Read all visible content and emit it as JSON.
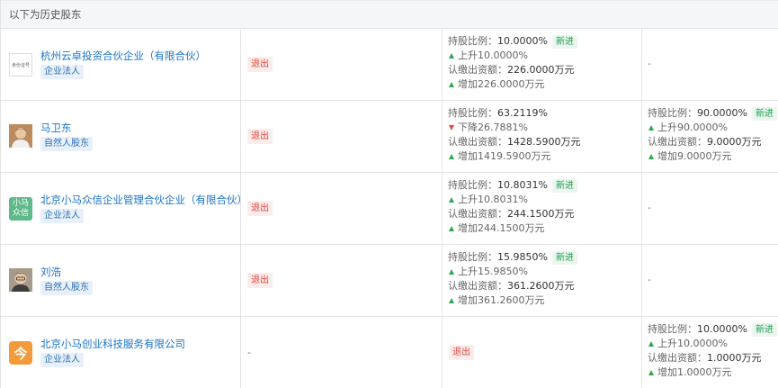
{
  "header": {
    "title": "以下为历史股东"
  },
  "rows": [
    {
      "name": "杭州云卓投资合伙企业（有限合伙）",
      "type": "企业法人",
      "logo_text": "身份证号",
      "col2": {
        "exit": "退出"
      },
      "col3": {
        "ratio_label": "持股比例：",
        "ratio": "10.0000%",
        "badge": "新进",
        "change": "上升10.0000%",
        "capital_label": "认缴出资额：",
        "capital": "226.0000万元",
        "capital_change": "增加226.0000万元"
      },
      "col4": {
        "dash": "-"
      }
    },
    {
      "name": "马卫东",
      "type": "自然人股东",
      "col2": {
        "exit": "退出"
      },
      "col3": {
        "ratio_label": "持股比例：",
        "ratio": "63.2119%",
        "change": "下降26.7881%",
        "capital_label": "认缴出资额：",
        "capital": "1428.5900万元",
        "capital_change": "增加1419.5900万元"
      },
      "col4": {
        "ratio_label": "持股比例：",
        "ratio": "90.0000%",
        "badge": "新进",
        "change": "上升90.0000%",
        "capital_label": "认缴出资额：",
        "capital": "9.0000万元",
        "capital_change": "增加9.0000万元"
      }
    },
    {
      "name": "北京小马众信企业管理合伙企业（有限合伙）",
      "type": "企业法人",
      "logo_line1": "小马",
      "logo_line2": "众信",
      "col2": {
        "exit": "退出"
      },
      "col3": {
        "ratio_label": "持股比例：",
        "ratio": "10.8031%",
        "badge": "新进",
        "change": "上升10.8031%",
        "capital_label": "认缴出资额：",
        "capital": "244.1500万元",
        "capital_change": "增加244.1500万元"
      },
      "col4": {
        "dash": "-"
      }
    },
    {
      "name": "刘浩",
      "type": "自然人股东",
      "col2": {
        "exit": "退出"
      },
      "col3": {
        "ratio_label": "持股比例：",
        "ratio": "15.9850%",
        "badge": "新进",
        "change": "上升15.9850%",
        "capital_label": "认缴出资额：",
        "capital": "361.2600万元",
        "capital_change": "增加361.2600万元"
      },
      "col4": {
        "dash": "-"
      }
    },
    {
      "name": "北京小马创业科技服务有限公司",
      "type": "企业法人",
      "logo_text": "今",
      "col2": {
        "dash": "-"
      },
      "col3": {
        "exit": "退出"
      },
      "col4": {
        "ratio_label": "持股比例：",
        "ratio": "10.0000%",
        "badge": "新进",
        "change": "上升10.0000%",
        "capital_label": "认缴出资额：",
        "capital": "1.0000万元",
        "capital_change": "增加1.0000万元"
      }
    }
  ]
}
